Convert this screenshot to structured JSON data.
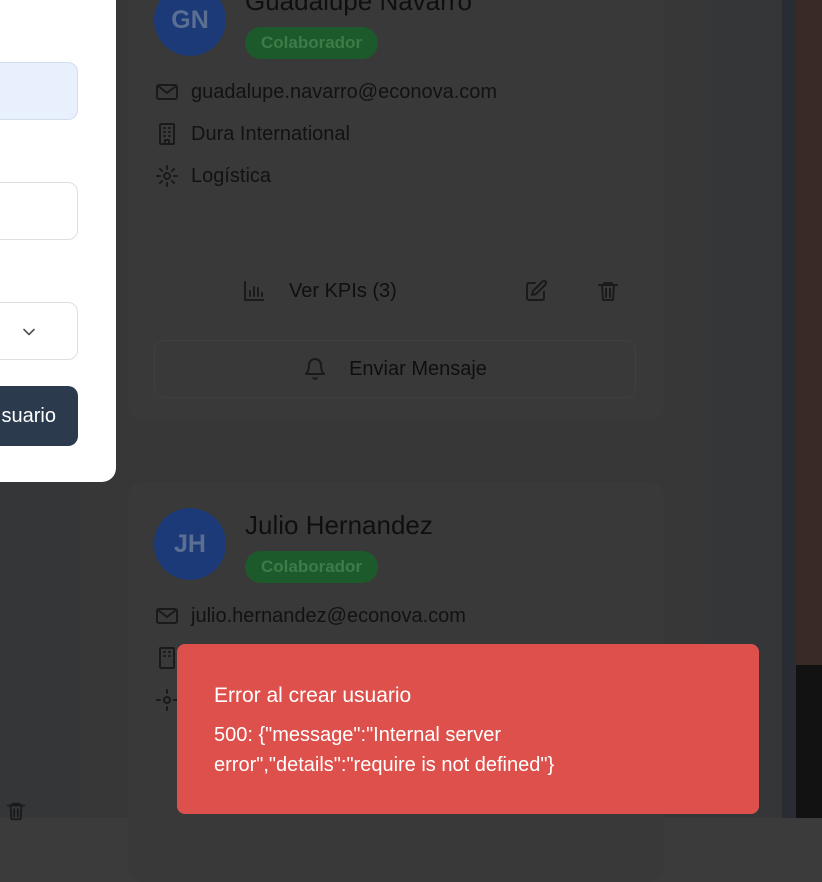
{
  "modal": {
    "submit_label": "suario"
  },
  "users": [
    {
      "initials": "GN",
      "name": "Guadalupe Navarro",
      "role": "Colaborador",
      "email": "guadalupe.navarro@econova.com",
      "company": "Dura International",
      "department": "Logística",
      "kpis_label": "Ver KPIs (3)",
      "message_label": "Enviar Mensaje"
    },
    {
      "initials": "JH",
      "name": "Julio Hernandez",
      "role": "Colaborador",
      "email": "julio.hernandez@econova.com"
    }
  ],
  "toast": {
    "title": "Error al crear usuario",
    "message": "500: {\"message\":\"Internal server error\",\"details\":\"require is not defined\"}"
  },
  "colors": {
    "toast_bg": "#de504b",
    "avatar_bg": "#1d3a78",
    "badge_bg": "#1d5a2b",
    "submit_bg": "#2c3a4e"
  }
}
